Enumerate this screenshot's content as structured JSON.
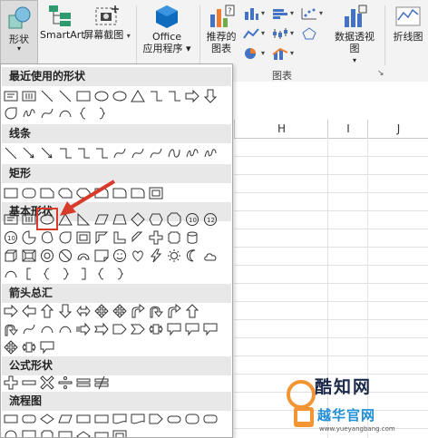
{
  "ribbon": {
    "shapes_label": "形状",
    "smartart_label": "SmartArt",
    "screenshot_label": "屏幕截图",
    "office_label_line1": "Office",
    "office_label_line2": "应用程序",
    "recommended_label_line1": "推荐的",
    "recommended_label_line2": "图表",
    "pivotchart_label": "数据透视图",
    "sparkline_label": "折线图",
    "charts_group_label": "图表"
  },
  "gallery": {
    "sections": [
      {
        "title": "最近使用的形状"
      },
      {
        "title": "线条"
      },
      {
        "title": "矩形"
      },
      {
        "title": "基本形状"
      },
      {
        "title": "箭头总汇"
      },
      {
        "title": "公式形状"
      },
      {
        "title": "流程图"
      }
    ],
    "selected_shape": "oval"
  },
  "sheet": {
    "columns": [
      "H",
      "I",
      "J"
    ]
  },
  "watermark": {
    "brand": "酷知网",
    "brand2": "越华官网",
    "url": "www.yueyangbang.com"
  },
  "colors": {
    "annotation": "#d93b2b",
    "office_icon": "#0f6cbd"
  }
}
